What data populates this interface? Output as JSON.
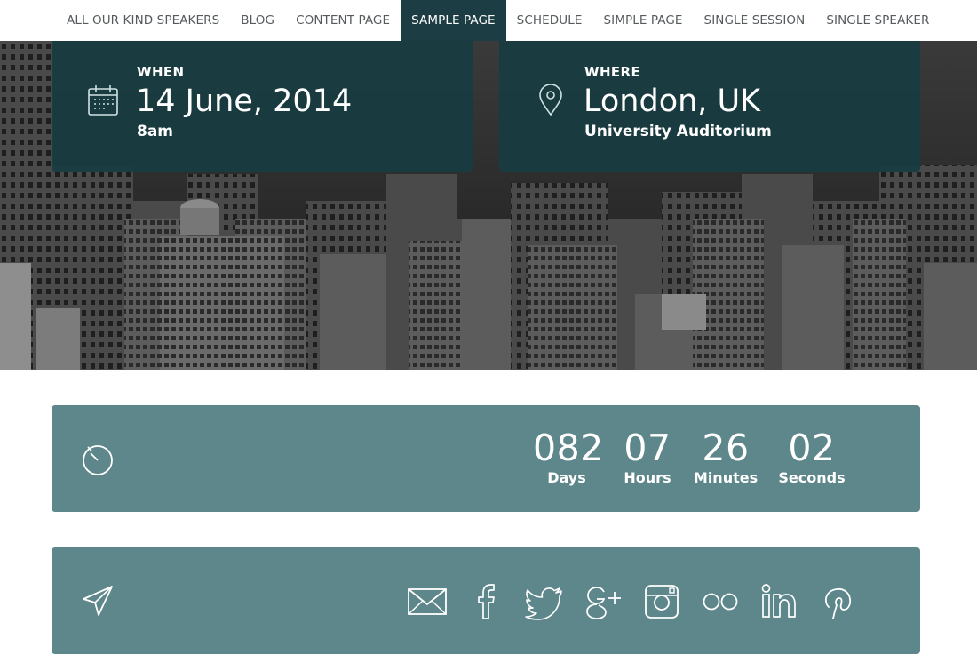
{
  "nav": {
    "items": [
      {
        "label": "ALL OUR KIND SPEAKERS",
        "active": false
      },
      {
        "label": "BLOG",
        "active": false
      },
      {
        "label": "CONTENT PAGE",
        "active": false
      },
      {
        "label": "SAMPLE PAGE",
        "active": true
      },
      {
        "label": "SCHEDULE",
        "active": false
      },
      {
        "label": "SIMPLE PAGE",
        "active": false
      },
      {
        "label": "SINGLE SESSION",
        "active": false
      },
      {
        "label": "SINGLE SPEAKER",
        "active": false
      }
    ]
  },
  "when": {
    "label": "WHEN",
    "date": "14 June, 2014",
    "time": "8am",
    "icon": "calendar-icon"
  },
  "where": {
    "label": "WHERE",
    "city": "London, UK",
    "venue": "University Auditorium",
    "icon": "map-pin-icon"
  },
  "countdown": {
    "icon": "timer-icon",
    "units": [
      {
        "value": "082",
        "label": "Days"
      },
      {
        "value": "07",
        "label": "Hours"
      },
      {
        "value": "26",
        "label": "Minutes"
      },
      {
        "value": "02",
        "label": "Seconds"
      }
    ]
  },
  "social": {
    "icon": "send-icon",
    "links": [
      "email-icon",
      "facebook-icon",
      "twitter-icon",
      "google-plus-icon",
      "instagram-icon",
      "flickr-icon",
      "linkedin-icon",
      "pinterest-icon"
    ]
  },
  "colors": {
    "card_bg": "#183c42",
    "panel_bg": "#5e878b",
    "nav_active": "#1d3d44"
  }
}
